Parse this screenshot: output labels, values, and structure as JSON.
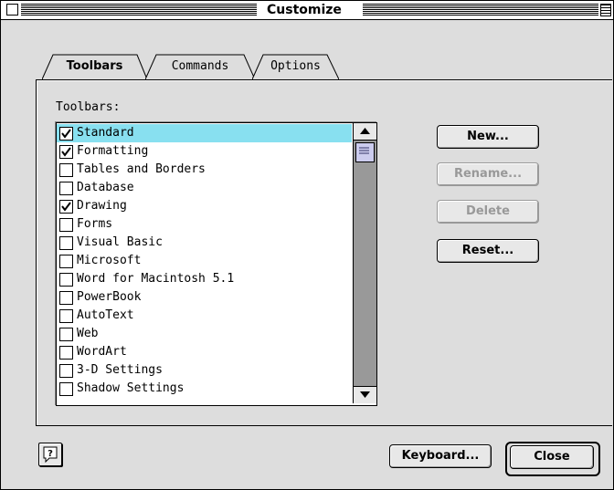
{
  "window": {
    "title": "Customize"
  },
  "tabs": [
    {
      "label": "Toolbars",
      "active": true
    },
    {
      "label": "Commands",
      "active": false
    },
    {
      "label": "Options",
      "active": false
    }
  ],
  "toolbars_label": "Toolbars:",
  "toolbars": [
    {
      "label": "Standard",
      "checked": true,
      "selected": true
    },
    {
      "label": "Formatting",
      "checked": true,
      "selected": false
    },
    {
      "label": "Tables and Borders",
      "checked": false,
      "selected": false
    },
    {
      "label": "Database",
      "checked": false,
      "selected": false
    },
    {
      "label": "Drawing",
      "checked": true,
      "selected": false
    },
    {
      "label": "Forms",
      "checked": false,
      "selected": false
    },
    {
      "label": "Visual Basic",
      "checked": false,
      "selected": false
    },
    {
      "label": "Microsoft",
      "checked": false,
      "selected": false
    },
    {
      "label": "Word for Macintosh 5.1",
      "checked": false,
      "selected": false
    },
    {
      "label": "PowerBook",
      "checked": false,
      "selected": false
    },
    {
      "label": "AutoText",
      "checked": false,
      "selected": false
    },
    {
      "label": "Web",
      "checked": false,
      "selected": false
    },
    {
      "label": "WordArt",
      "checked": false,
      "selected": false
    },
    {
      "label": "3-D Settings",
      "checked": false,
      "selected": false
    },
    {
      "label": "Shadow Settings",
      "checked": false,
      "selected": false
    }
  ],
  "buttons": {
    "new": "New...",
    "rename": "Rename...",
    "delete": "Delete",
    "reset": "Reset...",
    "keyboard": "Keyboard...",
    "close": "Close"
  },
  "colors": {
    "selection": "#88e0f0",
    "dialog_bg": "#dddddd"
  }
}
